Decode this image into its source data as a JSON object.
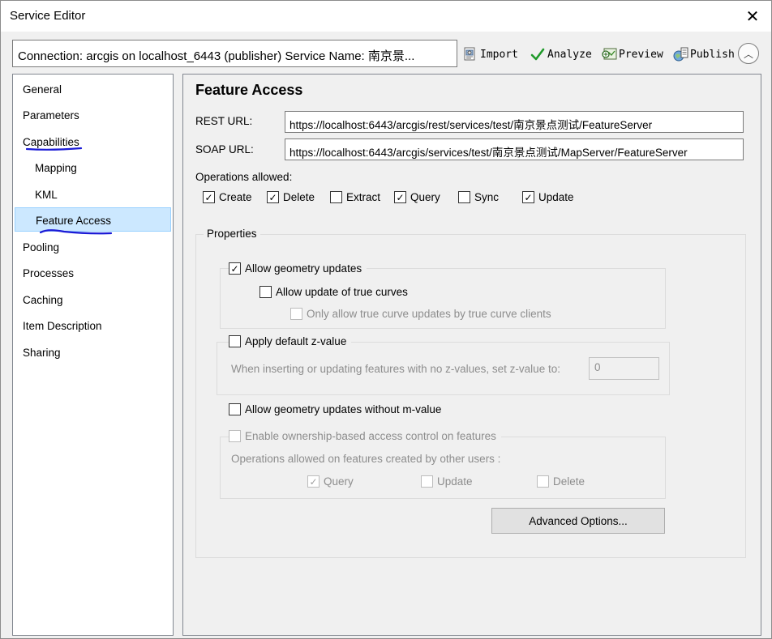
{
  "window": {
    "title": "Service Editor",
    "close_glyph": "✕"
  },
  "toolbar": {
    "connection_text": "Connection: arcgis on localhost_6443 (publisher)   Service Name: 南京景...",
    "import_label": "Import",
    "analyze_label": "Analyze",
    "preview_label": "Preview",
    "publish_label": "Publish",
    "collapse_glyph": "︿"
  },
  "sidebar": {
    "items": [
      {
        "label": "General"
      },
      {
        "label": "Parameters"
      },
      {
        "label": "Capabilities"
      },
      {
        "label": "Mapping"
      },
      {
        "label": "KML"
      },
      {
        "label": "Feature Access",
        "selected": true
      },
      {
        "label": "Pooling"
      },
      {
        "label": "Processes"
      },
      {
        "label": "Caching"
      },
      {
        "label": "Item Description"
      },
      {
        "label": "Sharing"
      }
    ]
  },
  "main": {
    "heading": "Feature Access",
    "rest_url_label": "REST URL:",
    "rest_url_value": "https://localhost:6443/arcgis/rest/services/test/南京景点测试/FeatureServer",
    "soap_url_label": "SOAP URL:",
    "soap_url_value": "https://localhost:6443/arcgis/services/test/南京景点测试/MapServer/FeatureServer",
    "operations_label": "Operations allowed:",
    "operations": [
      {
        "label": "Create",
        "checked": true
      },
      {
        "label": "Delete",
        "checked": true
      },
      {
        "label": "Extract",
        "checked": false
      },
      {
        "label": "Query",
        "checked": true
      },
      {
        "label": "Sync",
        "checked": false
      },
      {
        "label": "Update",
        "checked": true
      }
    ],
    "properties": {
      "title": "Properties",
      "allow_geometry_updates": {
        "label": "Allow geometry updates",
        "checked": true
      },
      "allow_true_curves": {
        "label": "Allow update of true curves",
        "checked": false
      },
      "only_true_curve_clients": {
        "label": "Only allow true curve updates by true curve clients",
        "checked": false
      },
      "apply_default_z": {
        "label": "Apply default z-value",
        "checked": false
      },
      "z_hint": "When inserting or updating features with no z-values, set z-value to:",
      "z_value": "0",
      "allow_without_m": {
        "label": "Allow geometry updates without m-value",
        "checked": false
      },
      "ownership": {
        "label": "Enable ownership-based access control on features",
        "checked": false
      },
      "ownership_hint": "Operations allowed on features created by other users :",
      "other_ops": [
        {
          "label": "Query",
          "checked": true
        },
        {
          "label": "Update",
          "checked": false
        },
        {
          "label": "Delete",
          "checked": false
        }
      ],
      "advanced_button": "Advanced Options..."
    }
  },
  "colors": {
    "selection_bg": "#cce8ff",
    "selection_border": "#99d1ff",
    "annotation_ink": "#1a1ad6",
    "analyze_check": "#1f9a2a"
  }
}
